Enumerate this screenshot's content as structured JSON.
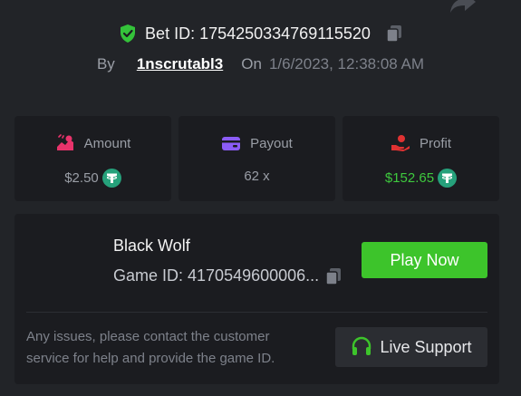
{
  "bet": {
    "id_label": "Bet ID: 1754250334769115520",
    "by_label": "By",
    "username": "1nscrutabl3",
    "on_label": "On",
    "date": "1/6/2023, 12:38:08 AM"
  },
  "stats": [
    {
      "label": "Amount",
      "value": "$2.50",
      "icon": "amount-icon",
      "color": "#e8336b"
    },
    {
      "label": "Payout",
      "value": "62 x",
      "icon": "wallet-icon",
      "color": "#8b5cf6"
    },
    {
      "label": "Profit",
      "value": "$152.65",
      "icon": "hand-coin-icon",
      "color": "#e03232"
    }
  ],
  "game": {
    "name": "Black Wolf",
    "id_label": "Game ID: 4170549600006...",
    "play_label": "Play Now",
    "issues_text": "Any issues, please contact the customer service for help and provide the game ID.",
    "support_label": "Live Support"
  },
  "colors": {
    "background": "#222428",
    "panel": "#1b1c20",
    "accent_green": "#3dc42b",
    "profit_green": "#3ec93e",
    "tether": "#26a17b"
  }
}
